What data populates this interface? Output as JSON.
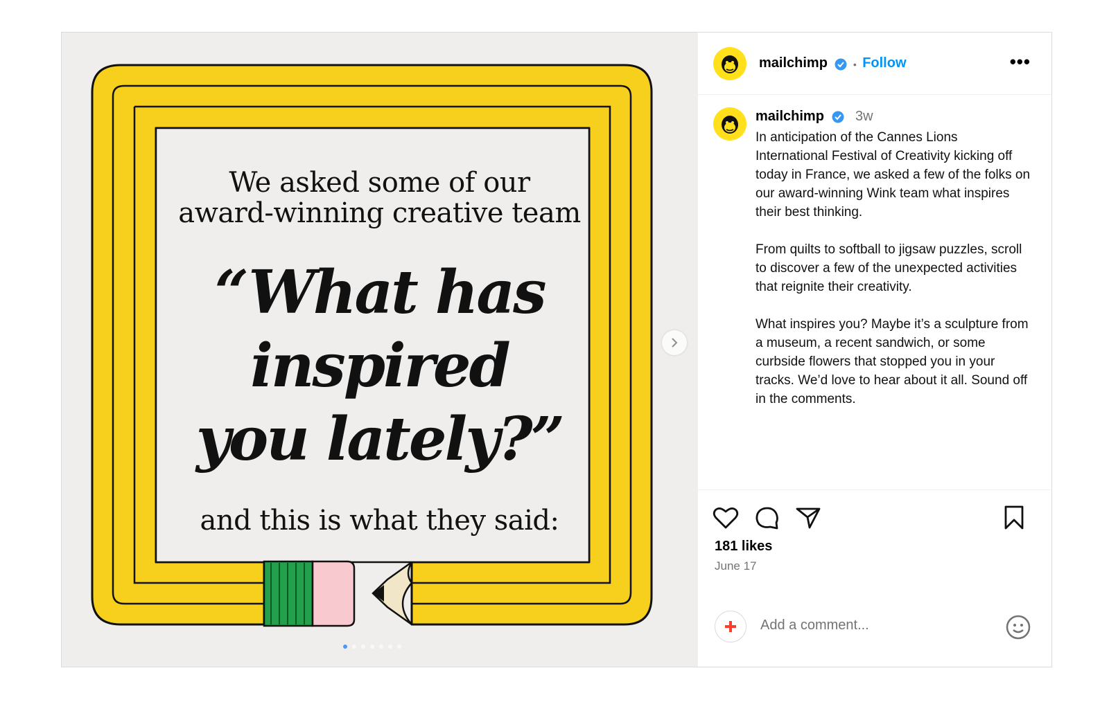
{
  "account": {
    "username": "mailchimp",
    "follow_label": "Follow",
    "separator": "•",
    "more_label": "•••"
  },
  "image": {
    "line1": "We asked some of our",
    "line2": "award-winning creative team",
    "quote": "“What has inspired you lately?”",
    "line3": "and this is what they said:",
    "carousel_count": 7,
    "carousel_active": 1
  },
  "caption": {
    "username": "mailchimp",
    "time": "3w",
    "text": "In anticipation of the Cannes Lions International Festival of Creativity kicking off today in France, we asked a few of the folks on our award-winning Wink team what inspires their best thinking.\n\nFrom quilts to softball to jigsaw puzzles, scroll to discover a few of the unexpected activities that reignite their creativity.\n\nWhat inspires you? Maybe it’s a sculpture from a museum, a recent sandwich, or some curbside flowers that stopped you in your tracks. We’d love to hear about it all. Sound off in the comments."
  },
  "stats": {
    "likes": "181 likes",
    "date": "June 17"
  },
  "comment": {
    "placeholder": "Add a comment..."
  },
  "icons": [
    "heart-icon",
    "comment-icon",
    "share-icon",
    "bookmark-icon",
    "emoji-icon",
    "chevron-right-icon",
    "verified-badge-icon"
  ],
  "colors": {
    "brand_yellow": "#ffe01b",
    "pencil_yellow": "#f7cf1d",
    "link_blue": "#0095f6",
    "verified_blue": "#3897f0",
    "eraser_pink": "#f8c9cf",
    "ferrule_green": "#22a04b"
  }
}
